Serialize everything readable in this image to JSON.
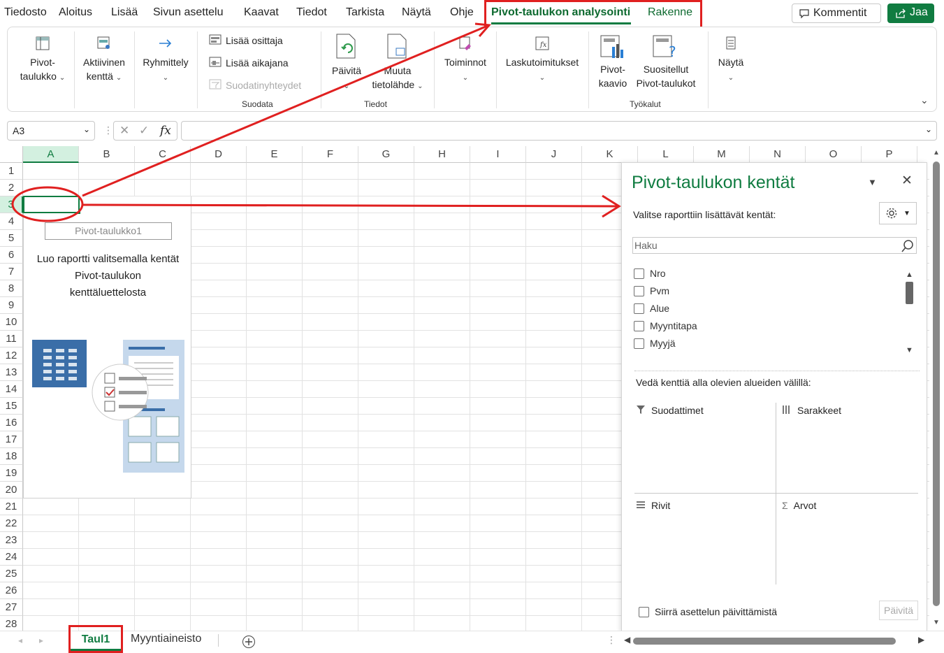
{
  "menu": {
    "items": [
      "Tiedosto",
      "Aloitus",
      "Lisää",
      "Sivun asettelu",
      "Kaavat",
      "Tiedot",
      "Tarkista",
      "Näytä",
      "Ohje"
    ],
    "context_tabs": [
      "Pivot-taulukon analysointi",
      "Rakenne"
    ],
    "comments": "Kommentit",
    "share": "Jaa"
  },
  "ribbon": {
    "pivot_table": [
      "Pivot-",
      "taulukko"
    ],
    "active_field": [
      "Aktiivinen",
      "kenttä"
    ],
    "group": "Ryhmittely",
    "insert_slicer": "Lisää osittaja",
    "insert_timeline": "Lisää aikajana",
    "filter_connections": "Suodatinyhteydet",
    "group_filter": "Suodata",
    "refresh": "Päivitä",
    "change_source": [
      "Muuta",
      "tietolähde"
    ],
    "group_data": "Tiedot",
    "actions": "Toiminnot",
    "calculations": "Laskutoimitukset",
    "pivot_chart": [
      "Pivot-",
      "kaavio"
    ],
    "recommended": [
      "Suositellut",
      "Pivot-taulukot"
    ],
    "group_tools": "Työkalut",
    "show": "Näytä"
  },
  "formula": {
    "name_box": "A3",
    "fx": "fx",
    "content": ""
  },
  "columns": [
    "A",
    "B",
    "C",
    "D",
    "E",
    "F",
    "G",
    "H",
    "I",
    "J",
    "K",
    "L",
    "M",
    "N",
    "O",
    "P"
  ],
  "rows": [
    "1",
    "2",
    "3",
    "4",
    "5",
    "6",
    "7",
    "8",
    "9",
    "10",
    "11",
    "12",
    "13",
    "14",
    "15",
    "16",
    "17",
    "18",
    "19",
    "20",
    "21",
    "22",
    "23",
    "24",
    "25",
    "26",
    "27",
    "28"
  ],
  "placeholder": {
    "name": "Pivot-taulukko1",
    "lines": [
      "Luo raportti valitsemalla kentät",
      "Pivot-taulukon",
      "kenttäluettelosta"
    ]
  },
  "pane": {
    "title": "Pivot-taulukon kentät",
    "choose": "Valitse raporttiin lisättävät kentät:",
    "search_placeholder": "Haku",
    "fields": [
      "Nro",
      "Pvm",
      "Alue",
      "Myyntitapa",
      "Myyjä"
    ],
    "drag": "Vedä kenttiä alla olevien alueiden välillä:",
    "areas": {
      "filters": "Suodattimet",
      "columns": "Sarakkeet",
      "rows": "Rivit",
      "values": "Arvot"
    },
    "defer": "Siirrä asettelun päivittämistä",
    "update": "Päivitä"
  },
  "sheets": {
    "active": "Taul1",
    "other": "Myyntiaineisto"
  },
  "colors": {
    "accent": "#107c41",
    "annotation": "#e02020"
  }
}
